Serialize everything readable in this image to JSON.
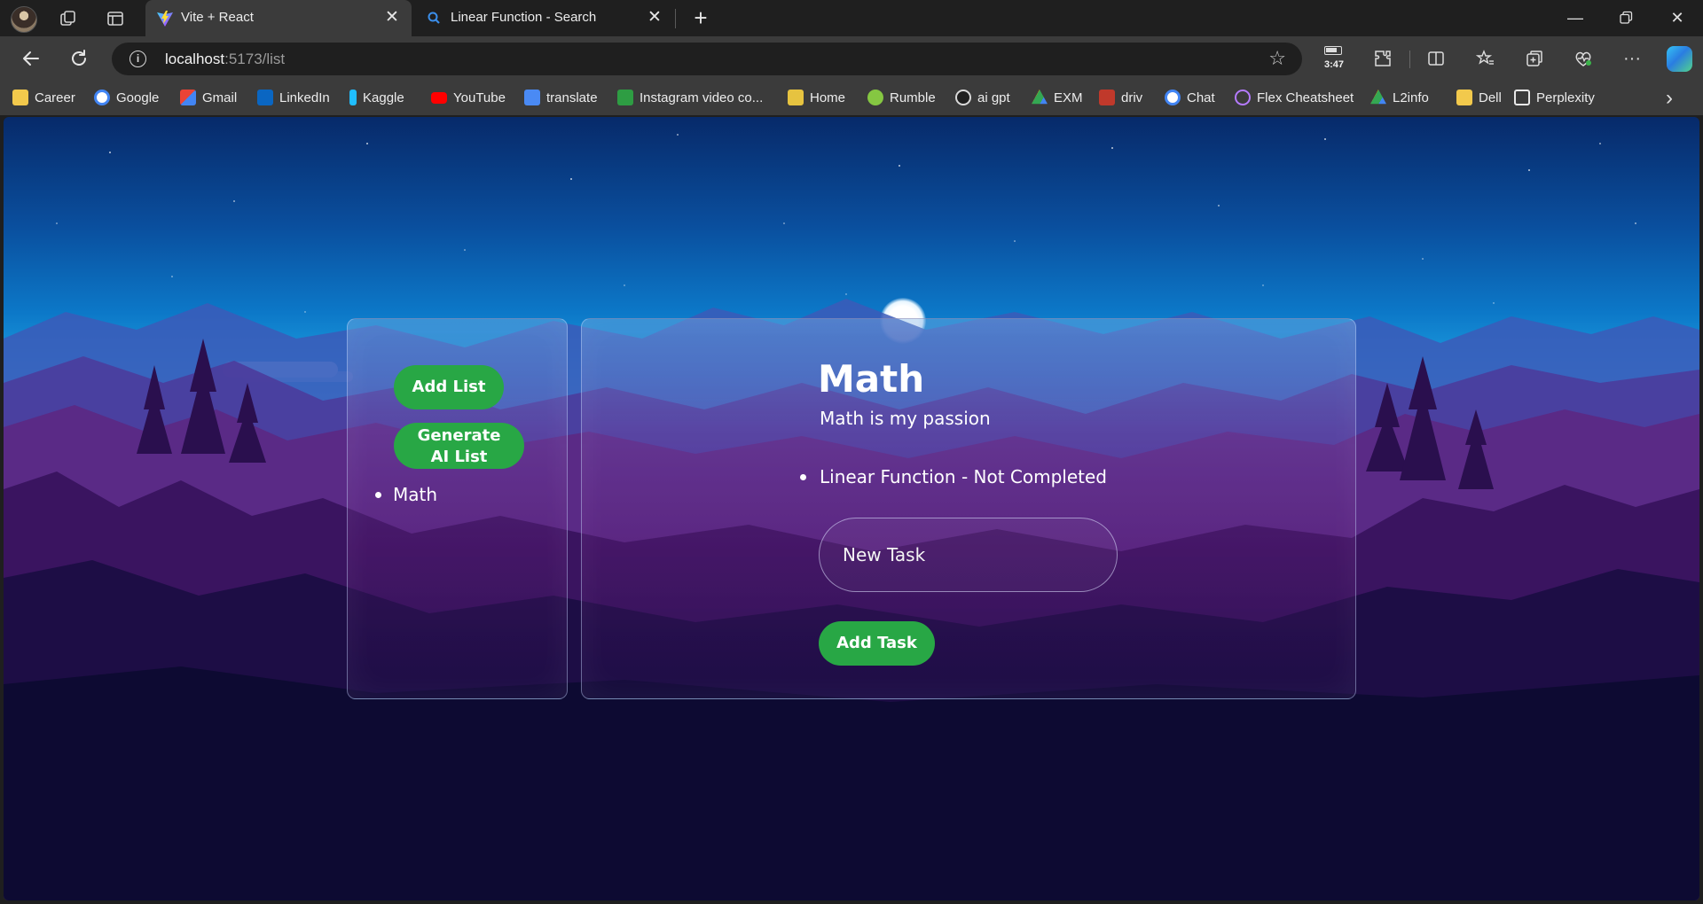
{
  "browser": {
    "tabs": [
      {
        "title": "Vite + React",
        "active": true
      },
      {
        "title": "Linear Function - Search",
        "active": false
      }
    ],
    "address": {
      "host": "localhost",
      "path": ":5173/list"
    },
    "battery_time": "3:47",
    "bookmarks": [
      {
        "label": "Career",
        "icon": "folder-icon",
        "color": "#f2c94c"
      },
      {
        "label": "Google",
        "icon": "google-icon",
        "color": "#ffffff"
      },
      {
        "label": "Gmail",
        "icon": "gmail-icon",
        "color": "#ea4335"
      },
      {
        "label": "LinkedIn",
        "icon": "linkedin-icon",
        "color": "#0a66c2"
      },
      {
        "label": "Kaggle",
        "icon": "kaggle-icon",
        "color": "#20beff"
      },
      {
        "label": "YouTube",
        "icon": "youtube-icon",
        "color": "#ff0000"
      },
      {
        "label": "translate",
        "icon": "translate-icon",
        "color": "#4a8af4"
      },
      {
        "label": "Instagram video co...",
        "icon": "instagram-video-icon",
        "color": "#2e9d43"
      },
      {
        "label": "Home",
        "icon": "home-icon",
        "color": "#e6c340"
      },
      {
        "label": "Rumble",
        "icon": "rumble-icon",
        "color": "#85c742"
      },
      {
        "label": "ai gpt",
        "icon": "openai-icon",
        "color": "#d9d9d9"
      },
      {
        "label": "EXM",
        "icon": "drive-icon",
        "color": "#34a853"
      },
      {
        "label": "driv",
        "icon": "driv-icon",
        "color": "#c0392b"
      },
      {
        "label": "Chat",
        "icon": "google-icon",
        "color": "#ffffff"
      },
      {
        "label": "Flex Cheatsheet",
        "icon": "flex-icon",
        "color": "#b57bff"
      },
      {
        "label": "L2info",
        "icon": "drive-icon",
        "color": "#fbbc04"
      },
      {
        "label": "Dell",
        "icon": "folder-icon",
        "color": "#f2c94c"
      },
      {
        "label": "Perplexity",
        "icon": "perplexity-icon",
        "color": "#e8e8e8"
      }
    ]
  },
  "app": {
    "sidebar": {
      "add_list_label": "Add List",
      "generate_ai_label_line1": "Generate",
      "generate_ai_label_line2": "AI List",
      "lists": [
        "Math"
      ]
    },
    "main": {
      "title": "Math",
      "description": "Math is my passion",
      "tasks": [
        "Linear Function - Not Completed"
      ],
      "new_task_placeholder": "New Task",
      "add_task_label": "Add Task"
    }
  },
  "colors": {
    "accent_green": "#28a745",
    "browser_dark": "#1f1f1f",
    "browser_toolbar": "#3b3b3b"
  }
}
